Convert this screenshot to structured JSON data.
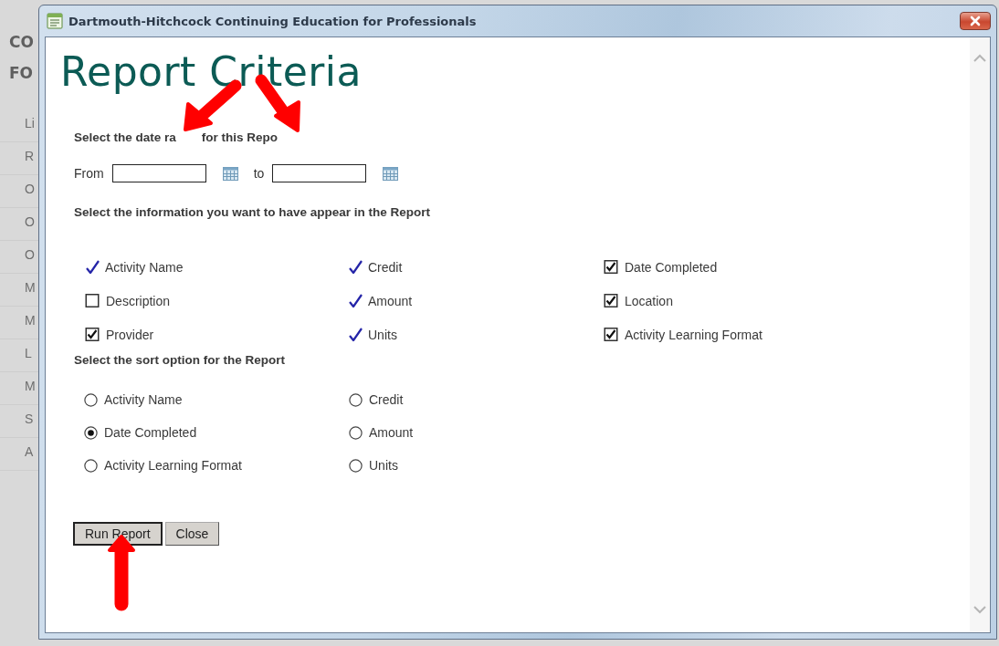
{
  "background_page": {
    "title_lines": [
      "CO",
      "FO"
    ],
    "sidebar_items": [
      "Li",
      "R",
      "O",
      "O",
      "O",
      "M",
      "M",
      "L",
      "M",
      "S",
      "A"
    ]
  },
  "window": {
    "title": "Dartmouth-Hitchcock Continuing Education for Professionals"
  },
  "page_title": "Report Criteria",
  "date_range": {
    "heading_parts": [
      "Select the date ra",
      "for this Repo"
    ],
    "from_label": "From",
    "to_label": "to"
  },
  "info_heading": "Select the information you want to have appear in the Report",
  "info_columns": [
    [
      {
        "label": "Activity Name",
        "kind": "tick",
        "checked": true
      },
      {
        "label": "Description",
        "kind": "checkbox",
        "checked": false
      },
      {
        "label": "Provider",
        "kind": "checkbox",
        "checked": true
      }
    ],
    [
      {
        "label": "Credit",
        "kind": "tick",
        "checked": true
      },
      {
        "label": "Amount",
        "kind": "tick",
        "checked": true
      },
      {
        "label": "Units",
        "kind": "tick",
        "checked": true
      }
    ],
    [
      {
        "label": "Date Completed",
        "kind": "checkbox",
        "checked": true
      },
      {
        "label": "Location",
        "kind": "checkbox",
        "checked": true
      },
      {
        "label": "Activity Learning Format",
        "kind": "checkbox",
        "checked": true
      }
    ]
  ],
  "sort_heading": "Select the sort option for the Report",
  "sort_columns": [
    [
      {
        "label": "Activity Name",
        "selected": false
      },
      {
        "label": "Date Completed",
        "selected": true
      },
      {
        "label": "Activity Learning Format",
        "selected": false
      }
    ],
    [
      {
        "label": "Credit",
        "selected": false
      },
      {
        "label": "Amount",
        "selected": false
      },
      {
        "label": "Units",
        "selected": false
      }
    ]
  ],
  "buttons": [
    {
      "label": "Run Report",
      "focused": true
    },
    {
      "label": "Close",
      "focused": false
    }
  ]
}
